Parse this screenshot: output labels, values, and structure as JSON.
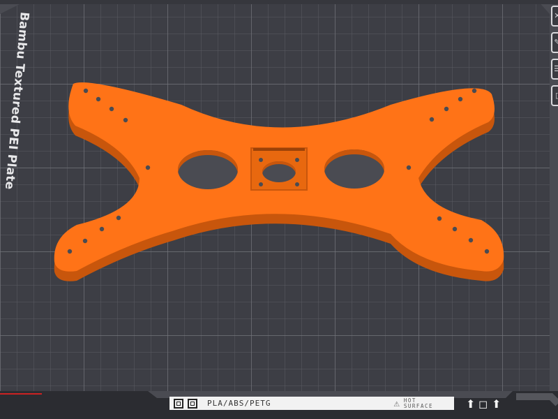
{
  "plate": {
    "name": "Bambu Textured PEI Plate",
    "material_label": "PLA/ABS/PETG",
    "warning_line1": "HOT",
    "warning_line2": "SURFACE"
  },
  "model": {
    "color": "#ff7317"
  },
  "toolbar": {
    "buttons": [
      "arrange-icon",
      "brush-icon",
      "layers-icon",
      "split-icon"
    ]
  },
  "bottom_icons": [
    "home-icon",
    "box-icon",
    "lift-icon"
  ]
}
